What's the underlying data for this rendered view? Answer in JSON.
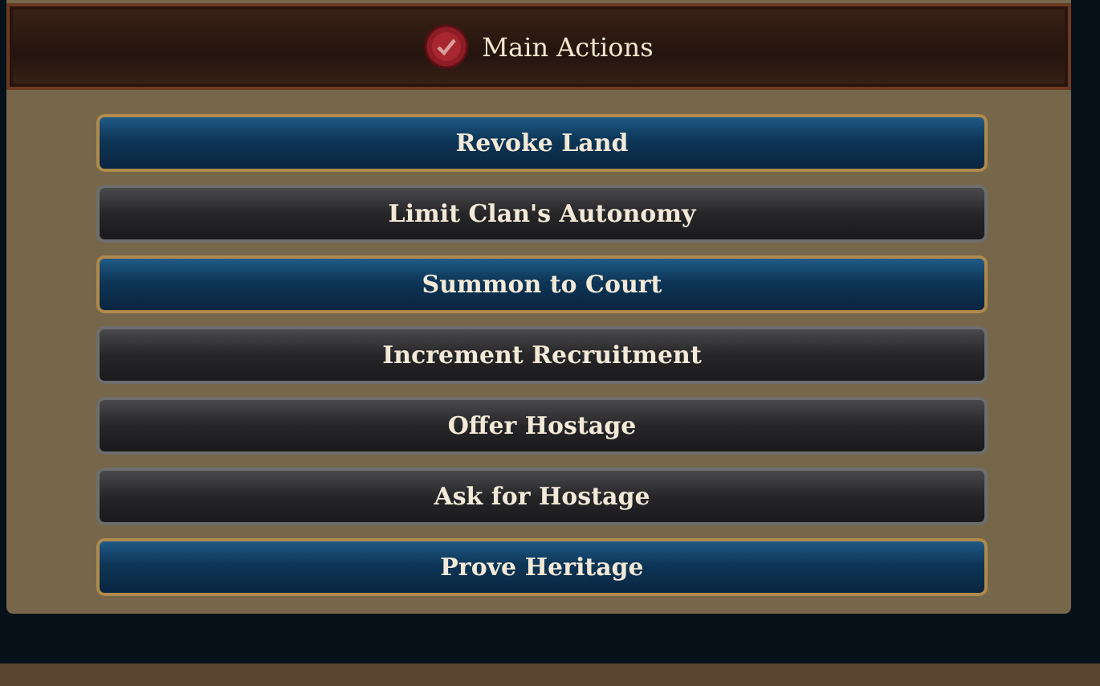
{
  "panel": {
    "title": "Main Actions"
  },
  "actions": [
    {
      "label": "Revoke Land",
      "available": true
    },
    {
      "label": "Limit Clan's Autonomy",
      "available": false
    },
    {
      "label": "Summon to Court",
      "available": true
    },
    {
      "label": "Increment Recruitment",
      "available": false
    },
    {
      "label": "Offer Hostage",
      "available": false
    },
    {
      "label": "Ask for Hostage",
      "available": false
    },
    {
      "label": "Prove Heritage",
      "available": true
    }
  ]
}
